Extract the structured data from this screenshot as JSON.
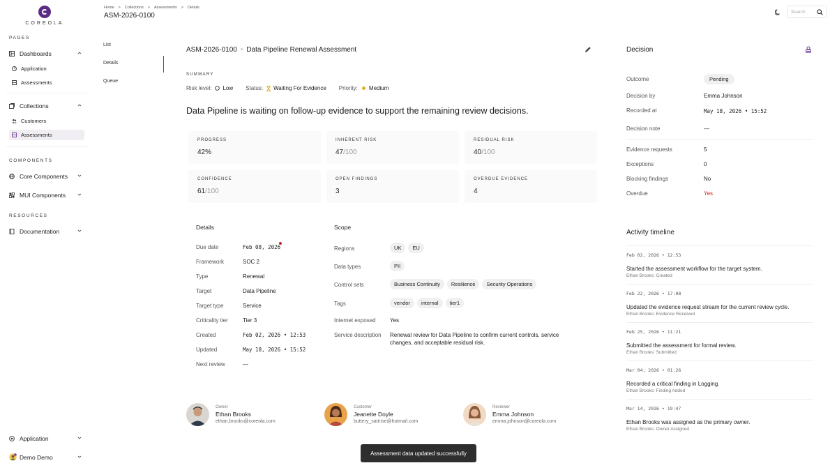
{
  "brand": {
    "name": "COREOLA",
    "color": "#5b2a86"
  },
  "sidebar": {
    "sections": [
      "PAGES",
      "COMPONENTS",
      "RESOURCES"
    ],
    "dashboards": "Dashboards",
    "dash_items": [
      "Application",
      "Assessments"
    ],
    "collections": "Collections",
    "coll_items": [
      "Customers",
      "Assessments"
    ],
    "core": "Core Components",
    "mui": "MUI Components",
    "docs": "Documentation",
    "app_switch": "Application",
    "user": "Demo Demo"
  },
  "header": {
    "crumbs": [
      "Home",
      "Collections",
      "Assessments",
      "Details"
    ],
    "page_id": "ASM-2026-0100",
    "search_placeholder": "Search"
  },
  "subnav": [
    "List",
    "Details",
    "Queue"
  ],
  "main": {
    "id": "ASM-2026-0100",
    "name": "Data Pipeline Renewal Assessment",
    "summary_label": "SUMMARY",
    "risk_label": "Risk level:",
    "risk_value": "Low",
    "status_label": "Status:",
    "status_value": "Waiting For Evidence",
    "priority_label": "Priority:",
    "priority_value": "Medium",
    "headline": "Data Pipeline is waiting on follow-up evidence to support the remaining review decisions.",
    "stats": [
      {
        "label": "PROGRESS",
        "value": "42%",
        "suffix": ""
      },
      {
        "label": "INHERENT RISK",
        "value": "47",
        "suffix": "/100"
      },
      {
        "label": "RESIDUAL RISK",
        "value": "40",
        "suffix": "/100"
      },
      {
        "label": "CONFIDENCE",
        "value": "61",
        "suffix": "/100"
      },
      {
        "label": "OPEN FINDINGS",
        "value": "3",
        "suffix": ""
      },
      {
        "label": "OVERDUE EVIDENCE",
        "value": "4",
        "suffix": ""
      }
    ],
    "details_title": "Details",
    "details": [
      {
        "k": "Due date",
        "v": "Feb 08, 2026"
      },
      {
        "k": "Framework",
        "v": "SOC 2"
      },
      {
        "k": "Type",
        "v": "Renewal"
      },
      {
        "k": "Target",
        "v": "Data Pipeline"
      },
      {
        "k": "Target type",
        "v": "Service"
      },
      {
        "k": "Criticality tier",
        "v": "Tier 3"
      },
      {
        "k": "Created",
        "v": "Feb 02, 2026 • 12:53"
      },
      {
        "k": "Updated",
        "v": "May 18, 2026 • 15:52"
      },
      {
        "k": "Next review",
        "v": "—"
      }
    ],
    "scope_title": "Scope",
    "scope": {
      "regions_label": "Regions",
      "regions": [
        "UK",
        "EU"
      ],
      "datatypes_label": "Data types",
      "datatypes": [
        "PII"
      ],
      "controls_label": "Control sets",
      "controls": [
        "Business Continuity",
        "Resilience",
        "Security Operations"
      ],
      "tags_label": "Tags",
      "tags": [
        "vendor",
        "internal",
        "tier1"
      ],
      "internet_label": "Internet exposed",
      "internet": "Yes",
      "desc_label": "Service description",
      "desc": "Renewal review for Data Pipeline to confirm current controls, service changes, and acceptable residual risk."
    },
    "people": [
      {
        "role": "Owner",
        "name": "Ethan Brooks",
        "email": "ethan.brooks@coreola.com"
      },
      {
        "role": "Customer",
        "name": "Jeanette Doyle",
        "email": "buttery_satirise@hotmail.com"
      },
      {
        "role": "Reviewer",
        "name": "Emma Johnson",
        "email": "emma.johnson@coreola.com"
      }
    ]
  },
  "decision": {
    "title": "Decision",
    "rows": [
      {
        "k": "Outcome",
        "v": "Pending"
      },
      {
        "k": "Decision by",
        "v": "Emma Johnson"
      },
      {
        "k": "Recorded at",
        "v": "May 18, 2026 • 15:52"
      },
      {
        "k": "Decision note",
        "v": "—"
      }
    ],
    "counts": [
      {
        "k": "Evidence requests",
        "v": "5"
      },
      {
        "k": "Exceptions",
        "v": "0"
      },
      {
        "k": "Blocking findings",
        "v": "No"
      },
      {
        "k": "Overdue",
        "v": "Yes"
      }
    ],
    "overdue_color": "#c62828"
  },
  "timeline": {
    "title": "Activity timeline",
    "items": [
      {
        "date": "Feb 02, 2026 • 12:53",
        "text": "Started the assessment workflow for the target system.",
        "sub": "Ethan Brooks: Created"
      },
      {
        "date": "Feb 22, 2026 • 17:08",
        "text": "Updated the evidence request stream for the current review cycle.",
        "sub": "Ethan Brooks: Evidence Received"
      },
      {
        "date": "Feb 25, 2026 • 11:21",
        "text": "Submitted the assessment for formal review.",
        "sub": "Ethan Brooks: Submitted"
      },
      {
        "date": "Mar 04, 2026 • 01:26",
        "text": "Recorded a critical finding in Logging.",
        "sub": "Ethan Brooks: Finding Added"
      },
      {
        "date": "Mar 14, 2026 • 19:47",
        "text": "Ethan Brooks was assigned as the primary owner.",
        "sub": "Ethan Brooks: Owner Assigned"
      }
    ]
  },
  "toast": "Assessment data updated successfully"
}
